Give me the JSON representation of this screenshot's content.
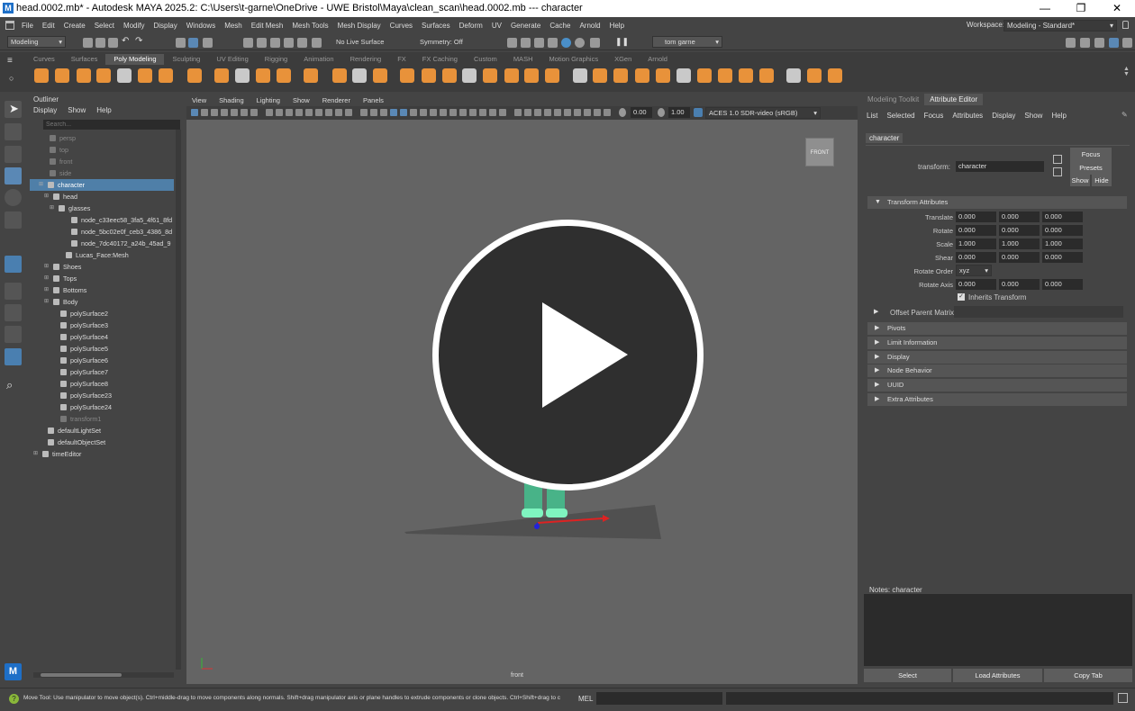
{
  "window": {
    "title": "head.0002.mb* - Autodesk MAYA 2025.2: C:\\Users\\t-garne\\OneDrive - UWE Bristol\\Maya\\clean_scan\\head.0002.mb   ---   character",
    "app_icon": "M",
    "minimize": "—",
    "maximize": "❐",
    "close": "✕"
  },
  "menubar": {
    "items": [
      "File",
      "Edit",
      "Create",
      "Select",
      "Modify",
      "Display",
      "Windows",
      "Mesh",
      "Edit Mesh",
      "Mesh Tools",
      "Mesh Display",
      "Curves",
      "Surfaces",
      "Deform",
      "UV",
      "Generate",
      "Cache",
      "Arnold",
      "Help"
    ],
    "workspace_label": "Workspace:",
    "workspace_value": "Modeling - Standard*"
  },
  "statusline": {
    "mode": "Modeling",
    "live_surface": "No Live Surface",
    "symmetry": "Symmetry: Off",
    "user": "tom garne"
  },
  "shelf": {
    "tabs": [
      "Curves",
      "Surfaces",
      "Poly Modeling",
      "Sculpting",
      "UV Editing",
      "Rigging",
      "Animation",
      "Rendering",
      "FX",
      "FX Caching",
      "Custom",
      "MASH",
      "Motion Graphics",
      "XGen",
      "Arnold"
    ],
    "active_tab": "Poly Modeling",
    "accent_color": "#e8923a"
  },
  "outliner": {
    "title": "Outliner",
    "menus": [
      "Display",
      "Show",
      "Help"
    ],
    "search_placeholder": "Search...",
    "rows": [
      {
        "label": "persp",
        "dim": true
      },
      {
        "label": "top",
        "dim": true
      },
      {
        "label": "front",
        "dim": true
      },
      {
        "label": "side",
        "dim": true
      },
      {
        "label": "character",
        "selected": true
      },
      {
        "label": "head"
      },
      {
        "label": "glasses"
      },
      {
        "label": "node_c33eec58_3fa5_4f61_8fd"
      },
      {
        "label": "node_5bc02e0f_ceb3_4386_8d"
      },
      {
        "label": "node_7dc40172_a24b_45ad_9"
      },
      {
        "label": "Lucas_Face:Mesh"
      },
      {
        "label": "Shoes"
      },
      {
        "label": "Tops"
      },
      {
        "label": "Bottoms"
      },
      {
        "label": "Body"
      },
      {
        "label": "polySurface2"
      },
      {
        "label": "polySurface3"
      },
      {
        "label": "polySurface4"
      },
      {
        "label": "polySurface5"
      },
      {
        "label": "polySurface6"
      },
      {
        "label": "polySurface7"
      },
      {
        "label": "polySurface8"
      },
      {
        "label": "polySurface23"
      },
      {
        "label": "polySurface24"
      },
      {
        "label": "transform1",
        "dim": true
      },
      {
        "label": "defaultLightSet"
      },
      {
        "label": "defaultObjectSet"
      },
      {
        "label": "timeEditor"
      }
    ]
  },
  "viewport": {
    "menus": [
      "View",
      "Shading",
      "Lighting",
      "Show",
      "Renderer",
      "Panels"
    ],
    "exposure": "0.00",
    "gamma": "1.00",
    "color_space": "ACES 1.0 SDR-video (sRGB)",
    "view_cube_label": "FRONT",
    "camera_label": "front",
    "play_icon": "play-icon"
  },
  "attribute_editor": {
    "tabs": [
      "Modeling Toolkit",
      "Attribute Editor"
    ],
    "active_tab": "Attribute Editor",
    "menus": [
      "List",
      "Selected",
      "Focus",
      "Attributes",
      "Display",
      "Show",
      "Help"
    ],
    "node_tab": "character",
    "transform_label": "transform:",
    "transform_value": "character",
    "focus_btn": "Focus",
    "presets_btn": "Presets",
    "show_btn": "Show",
    "hide_btn": "Hide",
    "section_transform": "Transform Attributes",
    "translate": {
      "label": "Translate",
      "values": [
        "0.000",
        "0.000",
        "0.000"
      ]
    },
    "rotate": {
      "label": "Rotate",
      "values": [
        "0.000",
        "0.000",
        "0.000"
      ]
    },
    "scale": {
      "label": "Scale",
      "values": [
        "1.000",
        "1.000",
        "1.000"
      ]
    },
    "shear": {
      "label": "Shear",
      "values": [
        "0.000",
        "0.000",
        "0.000"
      ]
    },
    "rotate_order": {
      "label": "Rotate Order",
      "value": "xyz"
    },
    "rotate_axis": {
      "label": "Rotate Axis",
      "values": [
        "0.000",
        "0.000",
        "0.000"
      ]
    },
    "inherits_transform": "Inherits Transform",
    "offset_parent_matrix": "Offset Parent Matrix",
    "sections": [
      "Pivots",
      "Limit Information",
      "Display",
      "Node Behavior",
      "UUID",
      "Extra Attributes"
    ],
    "notes_label": "Notes:  character",
    "bottom_buttons": [
      "Select",
      "Load Attributes",
      "Copy Tab"
    ]
  },
  "helpline": {
    "text": "Move Tool: Use manipulator to move object(s). Ctrl+middle-drag to move components along normals. Shift+drag manipulator axis or plane handles to extrude components or clone objects. Ctrl+Shift+drag to c",
    "mel_label": "MEL"
  }
}
